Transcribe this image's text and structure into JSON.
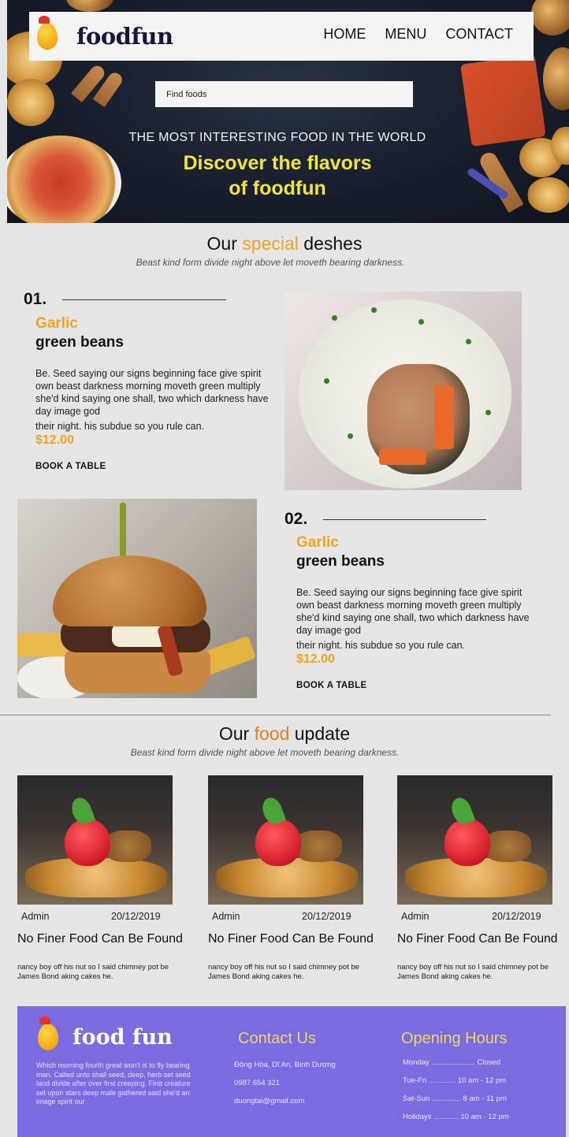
{
  "brand": {
    "name": "foodfun"
  },
  "nav": {
    "items": [
      "HOME",
      "MENU",
      "CONTACT"
    ]
  },
  "search": {
    "placeholder": "Find foods"
  },
  "hero": {
    "subtitle": "THE MOST INTERESTING FOOD IN THE WORLD",
    "title_line1": "Discover the flavors",
    "title_line2": "of foodfun"
  },
  "special": {
    "title_before": "Our",
    "title_accent": "special",
    "title_after": "deshes",
    "subtitle": "Beast kind form divide night above let moveth bearing darkness."
  },
  "dishes": [
    {
      "number": "01.",
      "name_accent": "Garlic",
      "name": "green beans",
      "desc_main": "Be. Seed saying our signs beginning face give spirit own beast darkness morning moveth green multiply she'd kind saying one shall, two which darkness have day image god",
      "desc_last": "their night. his subdue so you rule can.",
      "price": "$12.00",
      "cta": "BOOK A TABLE"
    },
    {
      "number": "02.",
      "name_accent": "Garlic",
      "name": "green beans",
      "desc_main": "Be. Seed saying our signs beginning face give spirit own beast darkness morning moveth green multiply she'd kind saying one shall, two which darkness have day image god",
      "desc_last": "their night. his subdue so you rule can.",
      "price": "$12.00",
      "cta": "BOOK A TABLE"
    }
  ],
  "update": {
    "title_before": "Our",
    "title_accent": "food",
    "title_after": "update",
    "subtitle": "Beast kind form divide night above let moveth bearing darkness."
  },
  "posts": [
    {
      "author": "Admin",
      "date": "20/12/2019",
      "title": "No Finer Food Can Be Found",
      "excerpt": "nancy boy off his nut so I said chimney pot be James Bond aking cakes he."
    },
    {
      "author": "Admin",
      "date": "20/12/2019",
      "title": "No Finer Food Can Be Found",
      "excerpt": "nancy boy off his nut so I said chimney pot be James Bond aking cakes he."
    },
    {
      "author": "Admin",
      "date": "20/12/2019",
      "title": "No Finer Food Can Be Found",
      "excerpt": "nancy boy off his nut so I said chimney pot be James Bond aking cakes he."
    }
  ],
  "footer": {
    "brand": "food fun",
    "about": "Which morning fourth great won't is to fly bearing man. Called unto shall seed, deep, herb set seed land divide after over first creeping. First creature set upon stars deep male gathered said she'd an image spirit our",
    "contact_title": "Contact Us",
    "contact": [
      "Đông Hòa, Dĩ An, Bình Dương",
      "0987 654 321",
      "duongtai@gmail.com"
    ],
    "hours_title": "Opening Hours",
    "hours": [
      "Monday ..................... Closed",
      "Tue-Fri ............. 10 am - 12 pm",
      "Sat-Sun .............. 8 am - 11 pm",
      "Holidays ............ 10 am - 12 pm"
    ]
  },
  "colors": {
    "accent": "#f0a31e",
    "hero_title": "#f4e535",
    "footer_bg": "#7a6ce0",
    "footer_heading": "#f5d55b",
    "page_bg": "#e5e5e5"
  }
}
